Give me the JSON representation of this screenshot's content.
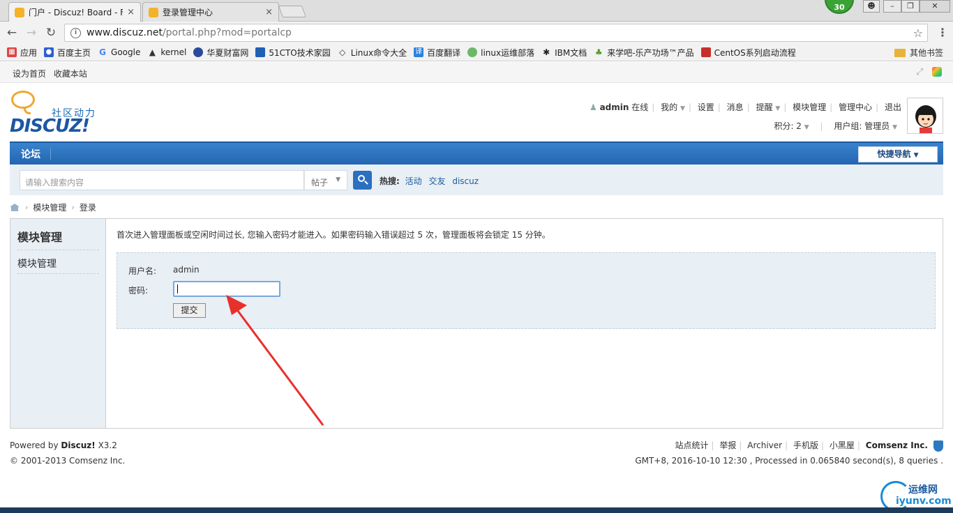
{
  "browser": {
    "tabs": [
      {
        "title": "门户 - Discuz! Board - F",
        "close": "×"
      },
      {
        "title": "登录管理中心",
        "close": "×"
      }
    ],
    "ext_badge": "30",
    "url_host": "www.discuz.net",
    "url_path": "/portal.php?mod=portalcp",
    "bookmarks": [
      "应用",
      "百度主页",
      "Google",
      "kernel",
      "华夏财富网",
      "51CTO技术家园",
      "Linux命令大全",
      "百度翻译",
      "linux运维部落",
      "IBM文档",
      "来学吧-乐产功场™产品",
      "CentOS系列启动流程"
    ],
    "other_bookmarks": "其他书签"
  },
  "topbar": {
    "set_home": "设为首页",
    "favorite": "收藏本站"
  },
  "logo": {
    "slogan": "社区动力",
    "word": "DISCUZ!"
  },
  "user": {
    "name": "admin",
    "status": "在线",
    "links": [
      "我的",
      "设置",
      "消息",
      "提醒",
      "模块管理",
      "管理中心",
      "退出"
    ],
    "credits": "积分: 2",
    "group": "用户组: 管理员"
  },
  "nav": {
    "forum": "论坛",
    "quick_nav": "快捷导航"
  },
  "search": {
    "placeholder": "请输入搜索内容",
    "type": "帖子",
    "hot_label": "热搜:",
    "hot": [
      "活动",
      "交友",
      "discuz"
    ]
  },
  "breadcrumb": [
    "模块管理",
    "登录"
  ],
  "sidebar": {
    "title": "模块管理",
    "item": "模块管理"
  },
  "content": {
    "notice": "首次进入管理面板或空闲时间过长, 您输入密码才能进入。如果密码输入错误超过 5 次，管理面板将会锁定 15 分钟。",
    "username_label": "用户名:",
    "username_value": "admin",
    "password_label": "密码:",
    "submit": "提交"
  },
  "footer": {
    "powered_by": "Powered by",
    "product": "Discuz!",
    "version": "X3.2",
    "copyright": "© 2001-2013 Comsenz Inc.",
    "links": [
      "站点统计",
      "举报",
      "Archiver",
      "手机版",
      "小黑屋"
    ],
    "company": "Comsenz Inc.",
    "processed": "GMT+8, 2016-10-10 12:30 , Processed in 0.065840 second(s), 8 queries ."
  },
  "watermark": {
    "line1": "运维网",
    "line2": "iyunv.com"
  }
}
